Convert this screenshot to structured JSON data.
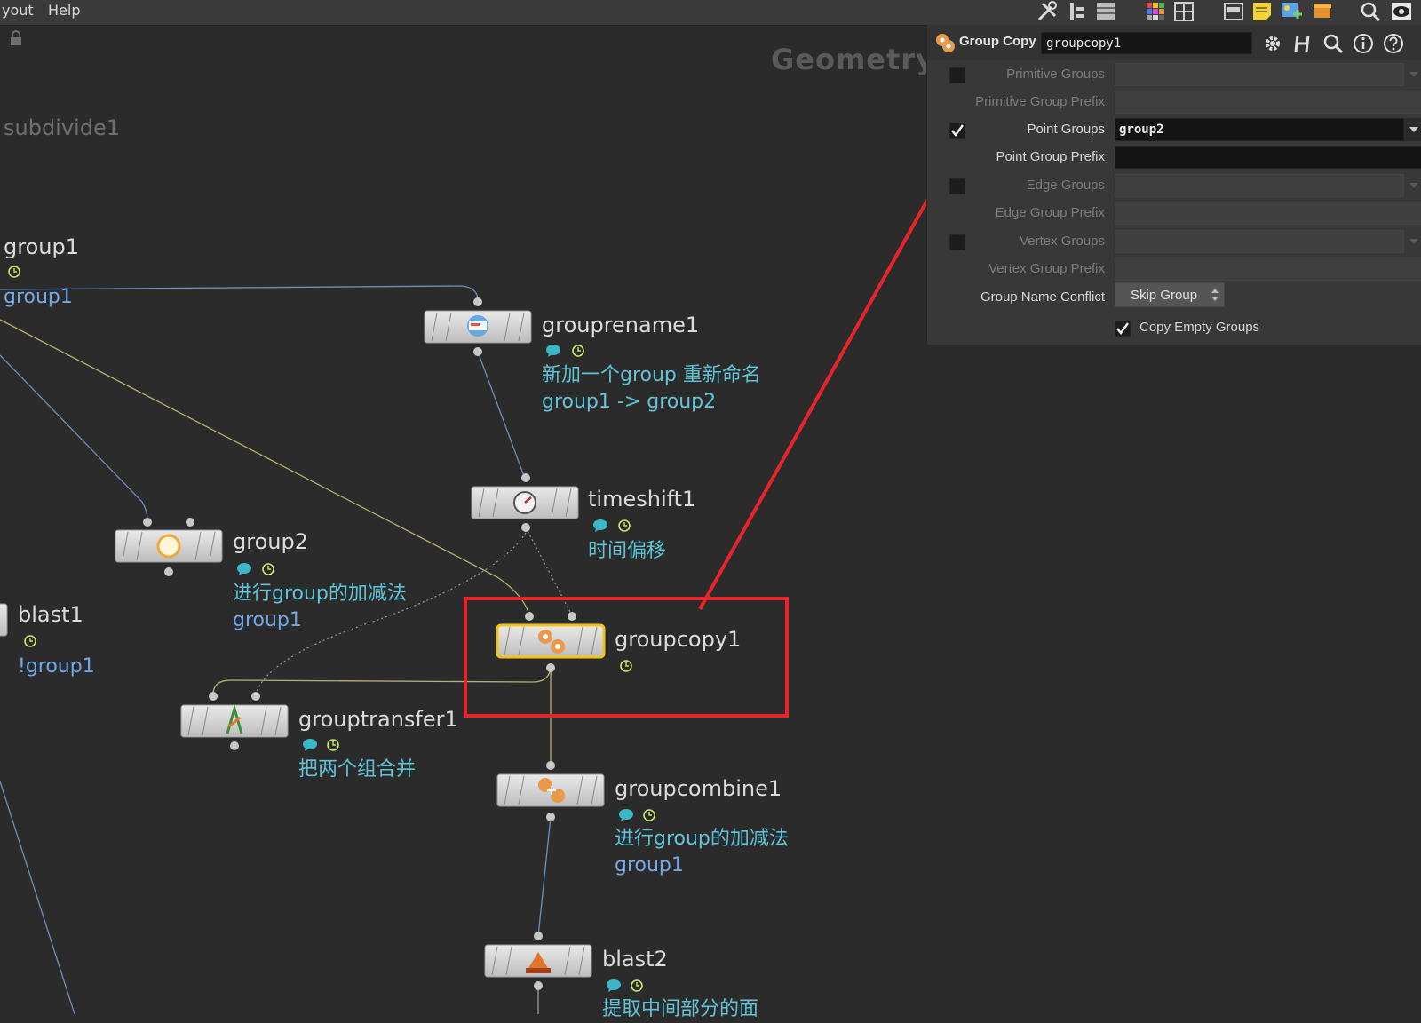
{
  "menu": {
    "layout": "yout",
    "help": "Help"
  },
  "toolbar_icons": [
    "tools-icon",
    "tree-icon",
    "list-icon",
    "color-palette-icon",
    "grid-icon",
    "layout-icon",
    "sticky-note-icon",
    "image-add-icon",
    "box-icon",
    "search-icon",
    "eye-icon"
  ],
  "network": {
    "title": "Geometry",
    "faded_node": "subdivide1",
    "nodes": {
      "group1": {
        "name": "group1",
        "group_label": "group1"
      },
      "grouprename1": {
        "name": "grouprename1",
        "comment1": "新加一个group 重新命名",
        "comment2": "group1 -> group2"
      },
      "timeshift1": {
        "name": "timeshift1",
        "comment": "时间偏移"
      },
      "group2": {
        "name": "group2",
        "comment": "进行group的加减法",
        "group_label": "group1"
      },
      "blast1": {
        "name": "blast1",
        "group_label": "!group1"
      },
      "groupcopy1": {
        "name": "groupcopy1"
      },
      "grouptransfer1": {
        "name": "grouptransfer1",
        "comment": "把两个组合并"
      },
      "groupcombine1": {
        "name": "groupcombine1",
        "comment": "进行group的加减法",
        "group_label": "group1"
      },
      "blast2": {
        "name": "blast2",
        "comment": "提取中间部分的面"
      }
    }
  },
  "panel": {
    "node_type": "Group Copy",
    "node_name": "groupcopy1",
    "params": {
      "primitive_groups": {
        "label": "Primitive Groups",
        "checked": false,
        "value": ""
      },
      "primitive_group_prefix": {
        "label": "Primitive Group Prefix",
        "value": ""
      },
      "point_groups": {
        "label": "Point Groups",
        "checked": true,
        "value": "group2"
      },
      "point_group_prefix": {
        "label": "Point Group Prefix",
        "value": ""
      },
      "edge_groups": {
        "label": "Edge Groups",
        "checked": false,
        "value": ""
      },
      "edge_group_prefix": {
        "label": "Edge Group Prefix",
        "value": ""
      },
      "vertex_groups": {
        "label": "Vertex Groups",
        "checked": false,
        "value": ""
      },
      "vertex_group_prefix": {
        "label": "Vertex Group Prefix",
        "value": ""
      },
      "group_name_conflict": {
        "label": "Group Name Conflict",
        "value": "Skip Group"
      },
      "copy_empty_groups": {
        "label": "Copy Empty Groups",
        "checked": true
      }
    }
  },
  "colors": {
    "background": "#2b2b2b",
    "highlight_box": "#e8242a",
    "annotation_arrow": "#e8242a",
    "comment_text": "#5fc4d6",
    "group_text": "#73a8e6",
    "selected_node_outline": "#f0c419"
  }
}
